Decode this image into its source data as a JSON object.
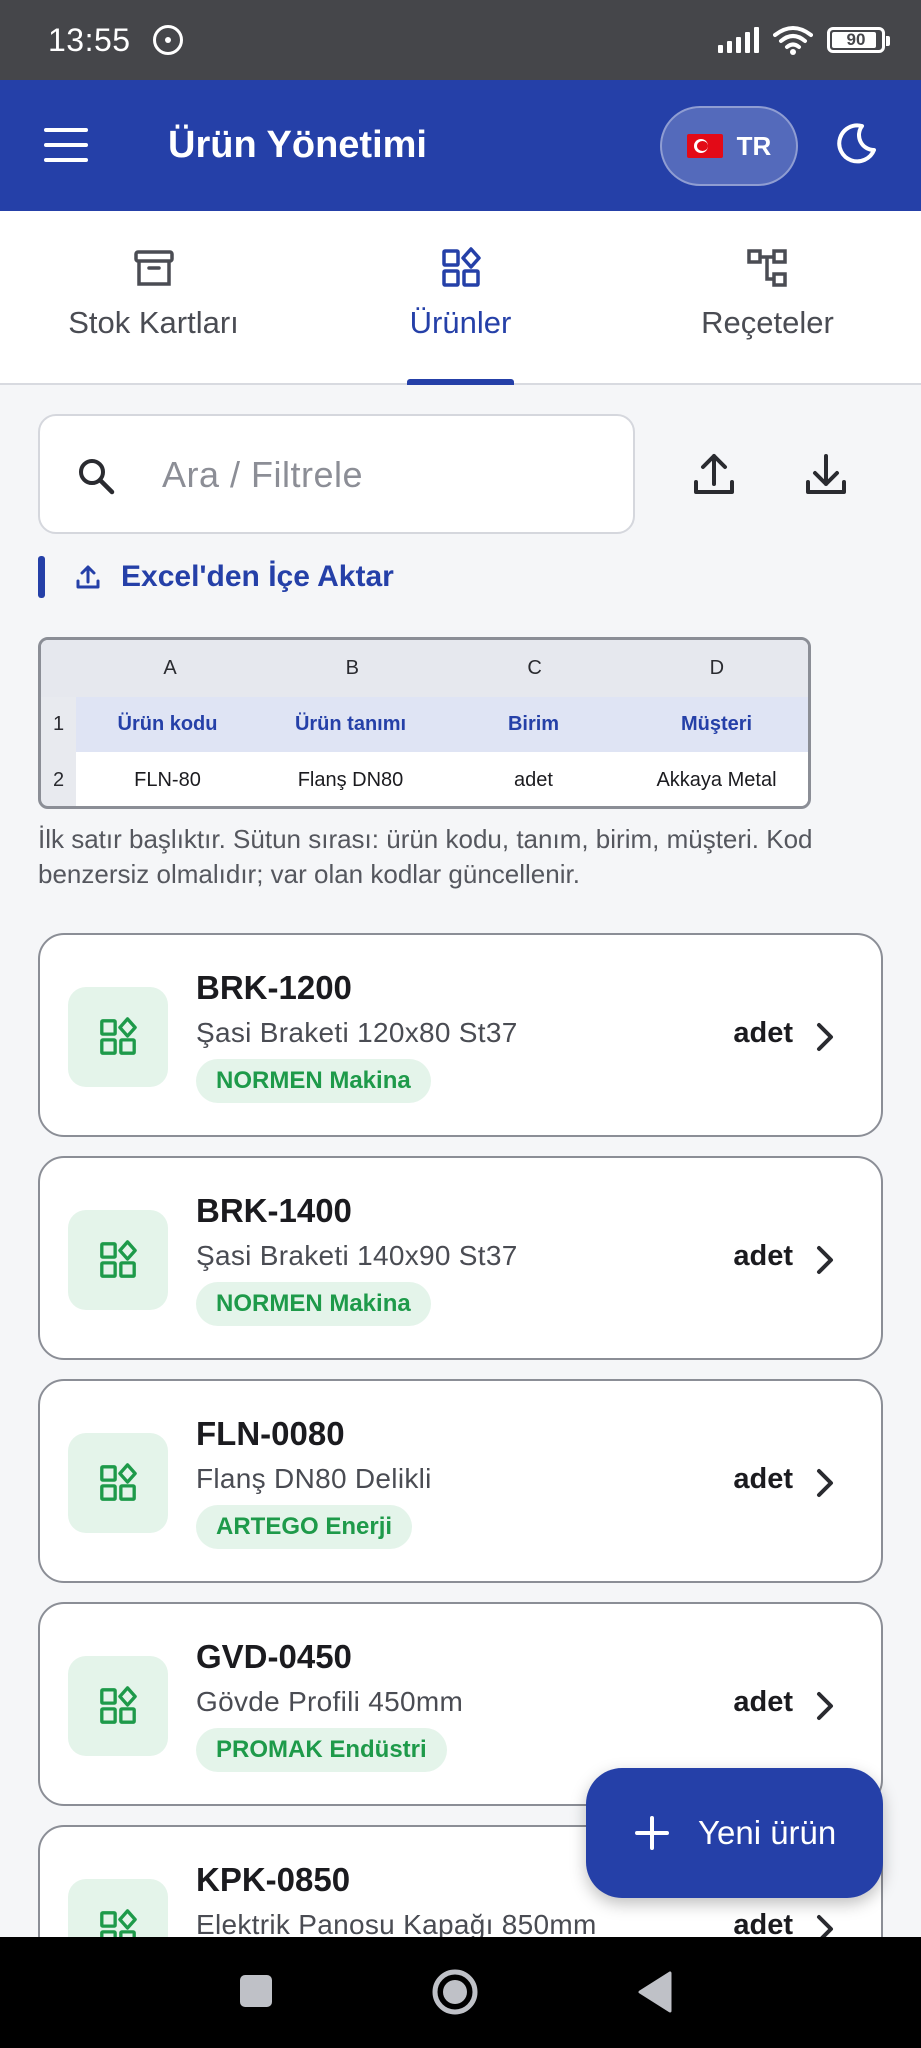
{
  "status_bar": {
    "time": "13:55",
    "battery": "90",
    "icons": [
      "notification-icon",
      "signal-icon",
      "wifi-icon",
      "battery-icon"
    ]
  },
  "app_bar": {
    "title": "Ürün Yönetimi",
    "language": "TR",
    "menu_icon": "hamburger-menu-icon",
    "theme_icon": "moon-icon",
    "primary_color": "#2540a8"
  },
  "tabs": [
    {
      "label": "Stok Kartları",
      "icon": "archive-box-icon",
      "active": false
    },
    {
      "label": "Ürünler",
      "icon": "grid-shapes-icon",
      "active": true
    },
    {
      "label": "Reçeteler",
      "icon": "tree-structure-icon",
      "active": false
    }
  ],
  "search": {
    "placeholder": "Ara / Filtrele"
  },
  "import": {
    "label": "Excel'den İçe Aktar"
  },
  "excel_preview": {
    "columns": [
      "A",
      "B",
      "C",
      "D"
    ],
    "rows": [
      {
        "num": "1",
        "cells": [
          "Ürün kodu",
          "Ürün tanımı",
          "Birim",
          "Müşteri"
        ]
      },
      {
        "num": "2",
        "cells": [
          "FLN-80",
          "Flanş DN80",
          "adet",
          "Akkaya Metal"
        ]
      }
    ]
  },
  "hint": "İlk satır başlıktır. Sütun sırası: ürün kodu, tanım, birim, müşteri. Kod benzersiz olmalıdır; var olan kodlar güncellenir.",
  "products": [
    {
      "code": "BRK-1200",
      "description": "Şasi Braketi 120x80 St37",
      "customer": "NORMEN Makina",
      "unit": "adet"
    },
    {
      "code": "BRK-1400",
      "description": "Şasi Braketi 140x90 St37",
      "customer": "NORMEN Makina",
      "unit": "adet"
    },
    {
      "code": "FLN-0080",
      "description": "Flanş DN80 Delikli",
      "customer": "ARTEGO Enerji",
      "unit": "adet"
    },
    {
      "code": "GVD-0450",
      "description": "Gövde Profili 450mm",
      "customer": "PROMAK Endüstri",
      "unit": "adet"
    },
    {
      "code": "KPK-0850",
      "description": "Elektrik Panosu Kapağı 850mm",
      "customer": "",
      "unit": "adet"
    }
  ],
  "fab": {
    "label": "Yeni ürün"
  }
}
